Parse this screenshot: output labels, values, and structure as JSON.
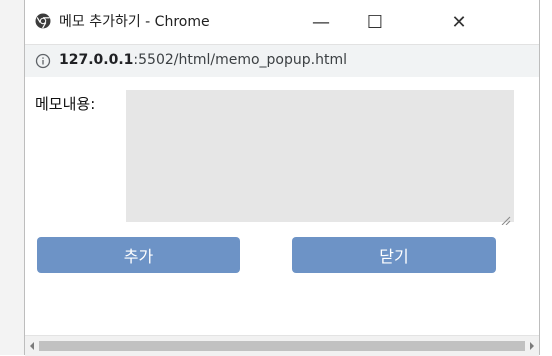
{
  "window": {
    "title": "메모 추가하기 - Chrome",
    "minimize_glyph": "—",
    "maximize_glyph": "☐",
    "close_glyph": "✕"
  },
  "address": {
    "host": "127.0.0.1",
    "rest": ":5502/html/memo_popup.html"
  },
  "form": {
    "memo_label": "메모내용:",
    "memo_value": "",
    "add_label": "추가",
    "close_label": "닫기"
  },
  "colors": {
    "button": "#6d93c6",
    "textarea": "#e6e6e6"
  },
  "icons": {
    "browser": "chrome-icon",
    "info": "info-icon"
  }
}
